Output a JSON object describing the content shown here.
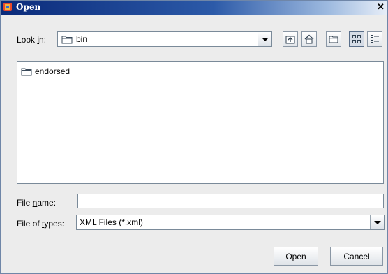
{
  "dialog": {
    "title": "Open",
    "close_glyph": "✕"
  },
  "look_in": {
    "label_prefix": "Look ",
    "label_mnemonic": "i",
    "label_suffix": "n:",
    "value": "bin",
    "icon": "folder-icon"
  },
  "toolbar": {
    "buttons": [
      {
        "name": "up-one-level-icon"
      },
      {
        "name": "home-icon"
      },
      {
        "name": "new-folder-icon"
      },
      {
        "name": "list-view-icon",
        "active": true
      },
      {
        "name": "details-view-icon"
      }
    ]
  },
  "files": [
    {
      "name": "endorsed",
      "icon": "folder-icon"
    }
  ],
  "file_name": {
    "label_prefix": "File ",
    "label_mnemonic": "n",
    "label_suffix": "ame:",
    "value": ""
  },
  "file_types": {
    "label_prefix": "File of ",
    "label_mnemonic": "t",
    "label_suffix": "ypes:",
    "value": "XML Files (*.xml)"
  },
  "actions": {
    "open_label": "Open",
    "cancel_label": "Cancel"
  }
}
